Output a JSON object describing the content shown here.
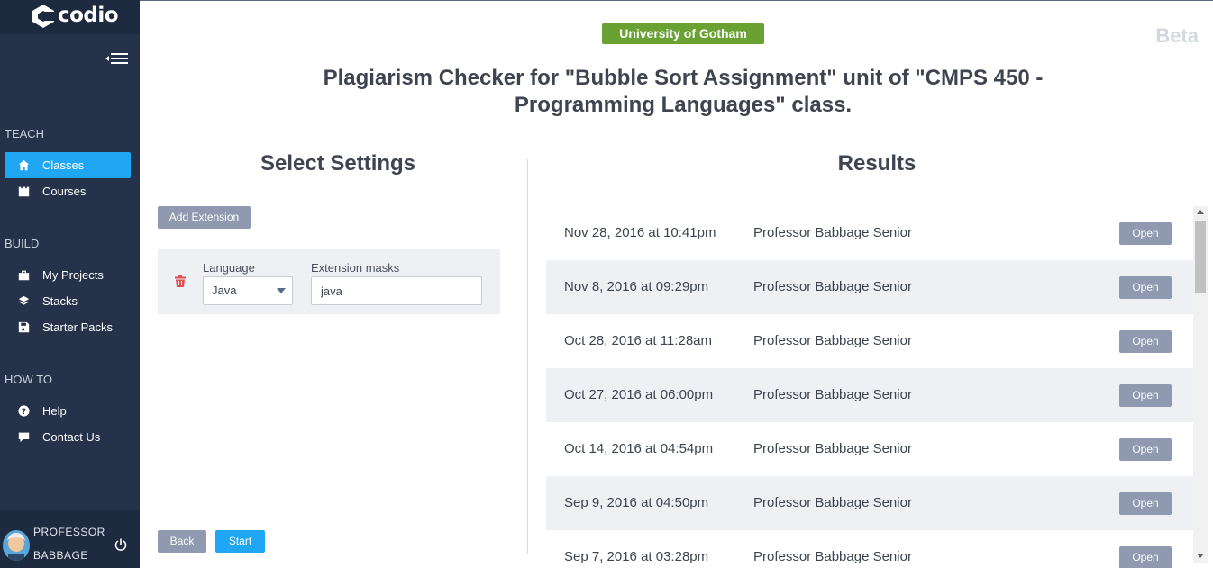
{
  "brand": {
    "name": "codio"
  },
  "sidebar": {
    "sections": [
      {
        "label": "TEACH",
        "items": [
          {
            "label": "Classes",
            "icon": "home-icon",
            "active": true
          },
          {
            "label": "Courses",
            "icon": "castle-icon",
            "active": false
          }
        ]
      },
      {
        "label": "BUILD",
        "items": [
          {
            "label": "My Projects",
            "icon": "briefcase-icon",
            "active": false
          },
          {
            "label": "Stacks",
            "icon": "layers-icon",
            "active": false
          },
          {
            "label": "Starter Packs",
            "icon": "save-icon",
            "active": false
          }
        ]
      },
      {
        "label": "HOW TO",
        "items": [
          {
            "label": "Help",
            "icon": "question-circle-icon",
            "active": false
          },
          {
            "label": "Contact Us",
            "icon": "chat-bubble-icon",
            "active": false
          }
        ]
      }
    ],
    "user": {
      "first": "PROFESSOR",
      "last": "BABBAGE"
    }
  },
  "header": {
    "org": "University of Gotham",
    "beta": "Beta",
    "title": "Plagiarism Checker for \"Bubble Sort Assignment\" unit of \"CMPS 450 - Programming Languages\" class."
  },
  "settings": {
    "heading": "Select Settings",
    "add_extension_label": "Add Extension",
    "language_label": "Language",
    "language_value": "Java",
    "mask_label": "Extension masks",
    "mask_value": "java",
    "back_label": "Back",
    "start_label": "Start"
  },
  "results": {
    "heading": "Results",
    "open_label": "Open",
    "rows": [
      {
        "date": "Nov 28, 2016 at 10:41pm",
        "author": "Professor Babbage Senior"
      },
      {
        "date": "Nov 8, 2016 at 09:29pm",
        "author": "Professor Babbage Senior"
      },
      {
        "date": "Oct 28, 2016 at 11:28am",
        "author": "Professor Babbage Senior"
      },
      {
        "date": "Oct 27, 2016 at 06:00pm",
        "author": "Professor Babbage Senior"
      },
      {
        "date": "Oct 14, 2016 at 04:54pm",
        "author": "Professor Babbage Senior"
      },
      {
        "date": "Sep 9, 2016 at 04:50pm",
        "author": "Professor Babbage Senior"
      },
      {
        "date": "Sep 7, 2016 at 03:28pm",
        "author": "Professor Babbage Senior"
      }
    ]
  },
  "colors": {
    "sidebar": "#25324a",
    "accent": "#1fa7f3",
    "org_badge": "#69a132",
    "grey_button": "#8f9ab0"
  }
}
